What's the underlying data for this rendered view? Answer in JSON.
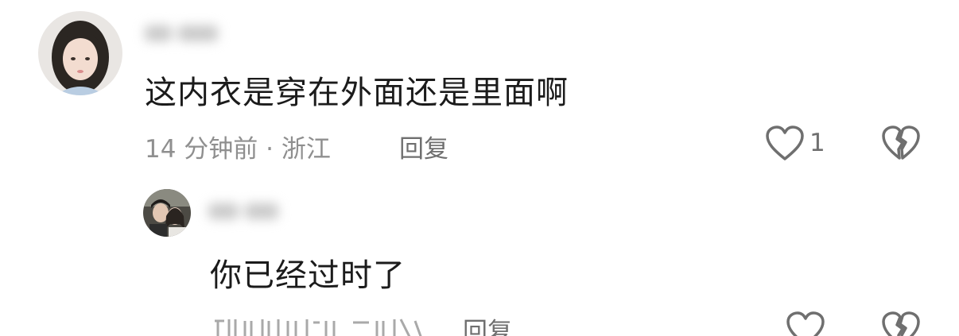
{
  "comments": [
    {
      "text": "这内衣是穿在外面还是里面啊",
      "meta": "14 分钟前 · 浙江",
      "reply_label": "回复",
      "like_count": "1"
    },
    {
      "text": "你已经过时了",
      "meta": "",
      "reply_label": "回复"
    }
  ],
  "icons": {
    "like": "heart-outline-icon",
    "dislike": "broken-heart-icon"
  },
  "colors": {
    "text": "#1b1b1b",
    "meta": "#8f8f8f",
    "icon": "#6f6f6f"
  }
}
